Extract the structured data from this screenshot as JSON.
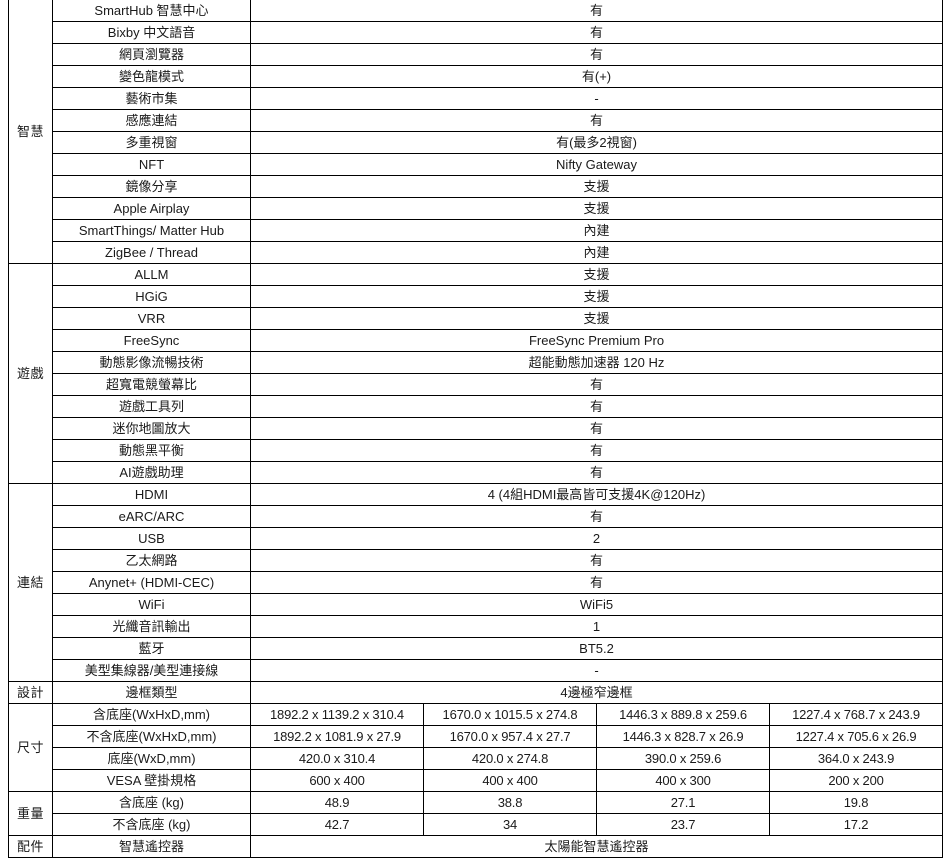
{
  "table": {
    "columns": {
      "section_header": "",
      "feature_header": "",
      "models": [
        "",
        "",
        "",
        ""
      ]
    },
    "sections": [
      {
        "name": "智慧",
        "rows": [
          {
            "feature": "SmartHub 智慧中心",
            "merged": true,
            "value": "有"
          },
          {
            "feature": "Bixby 中文語音",
            "merged": true,
            "value": "有"
          },
          {
            "feature": "網頁瀏覽器",
            "merged": true,
            "value": "有"
          },
          {
            "feature": "變色龍模式",
            "merged": true,
            "value": "有(+)"
          },
          {
            "feature": "藝術市集",
            "merged": true,
            "value": "-"
          },
          {
            "feature": "感應連結",
            "merged": true,
            "value": "有"
          },
          {
            "feature": "多重視窗",
            "merged": true,
            "value": "有(最多2視窗)"
          },
          {
            "feature": "NFT",
            "merged": true,
            "value": "Nifty Gateway"
          },
          {
            "feature": "鏡像分享",
            "merged": true,
            "value": "支援"
          },
          {
            "feature": "Apple Airplay",
            "merged": true,
            "value": "支援"
          },
          {
            "feature": "SmartThings/ Matter Hub",
            "merged": true,
            "value": "內建"
          },
          {
            "feature": "ZigBee / Thread",
            "merged": true,
            "value": "內建"
          }
        ]
      },
      {
        "name": "遊戲",
        "rows": [
          {
            "feature": "ALLM",
            "merged": true,
            "value": "支援"
          },
          {
            "feature": "HGiG",
            "merged": true,
            "value": "支援"
          },
          {
            "feature": "VRR",
            "merged": true,
            "value": "支援"
          },
          {
            "feature": "FreeSync",
            "merged": true,
            "value": "FreeSync Premium Pro"
          },
          {
            "feature": "動態影像流暢技術",
            "merged": true,
            "value": "超能動態加速器 120 Hz"
          },
          {
            "feature": "超寬電競螢幕比",
            "merged": true,
            "value": "有"
          },
          {
            "feature": "遊戲工具列",
            "merged": true,
            "value": "有"
          },
          {
            "feature": "迷你地圖放大",
            "merged": true,
            "value": "有"
          },
          {
            "feature": "動態黑平衡",
            "merged": true,
            "value": "有"
          },
          {
            "feature": "AI遊戲助理",
            "merged": true,
            "value": "有"
          }
        ]
      },
      {
        "name": "連結",
        "rows": [
          {
            "feature": "HDMI",
            "merged": true,
            "value": "4  (4組HDMI最高皆可支援4K@120Hz)"
          },
          {
            "feature": "eARC/ARC",
            "merged": true,
            "value": "有"
          },
          {
            "feature": "USB",
            "merged": true,
            "value": "2"
          },
          {
            "feature": "乙太網路",
            "merged": true,
            "value": "有"
          },
          {
            "feature": "Anynet+ (HDMI-CEC)",
            "merged": true,
            "value": "有"
          },
          {
            "feature": "WiFi",
            "merged": true,
            "value": "WiFi5"
          },
          {
            "feature": "光纖音訊輸出",
            "merged": true,
            "value": "1"
          },
          {
            "feature": "藍牙",
            "merged": true,
            "value": "BT5.2"
          },
          {
            "feature": "美型集線器/美型連接線",
            "merged": true,
            "value": "-"
          }
        ]
      },
      {
        "name": "設計",
        "rows": [
          {
            "feature": "邊框類型",
            "merged": true,
            "value": "4邊極窄邊框"
          }
        ]
      },
      {
        "name": "尺寸",
        "rows": [
          {
            "feature": "含底座(WxHxD,mm)",
            "merged": false,
            "values": [
              "1892.2 x 1139.2 x 310.4",
              "1670.0 x 1015.5 x 274.8",
              "1446.3 x 889.8 x 259.6",
              "1227.4 x 768.7 x 243.9"
            ]
          },
          {
            "feature": "不含底座(WxHxD,mm)",
            "merged": false,
            "values": [
              "1892.2 x 1081.9 x 27.9",
              "1670.0 x 957.4 x 27.7",
              "1446.3 x 828.7 x 26.9",
              "1227.4 x 705.6 x 26.9"
            ]
          },
          {
            "feature": "底座(WxD,mm)",
            "merged": false,
            "values": [
              "420.0 x 310.4",
              "420.0 x 274.8",
              "390.0 x 259.6",
              "364.0 x 243.9"
            ]
          },
          {
            "feature": "VESA 壁掛規格",
            "merged": false,
            "values": [
              "600 x 400",
              "400 x 400",
              "400 x 300",
              "200 x 200"
            ]
          }
        ]
      },
      {
        "name": "重量",
        "rows": [
          {
            "feature": "含底座 (kg)",
            "merged": false,
            "values": [
              "48.9",
              "38.8",
              "27.1",
              "19.8"
            ]
          },
          {
            "feature": "不含底座 (kg)",
            "merged": false,
            "values": [
              "42.7",
              "34",
              "23.7",
              "17.2"
            ]
          }
        ]
      },
      {
        "name": "配件",
        "rows": [
          {
            "feature": "智慧遙控器",
            "merged": true,
            "value": "太陽能智慧遙控器"
          }
        ]
      }
    ]
  }
}
